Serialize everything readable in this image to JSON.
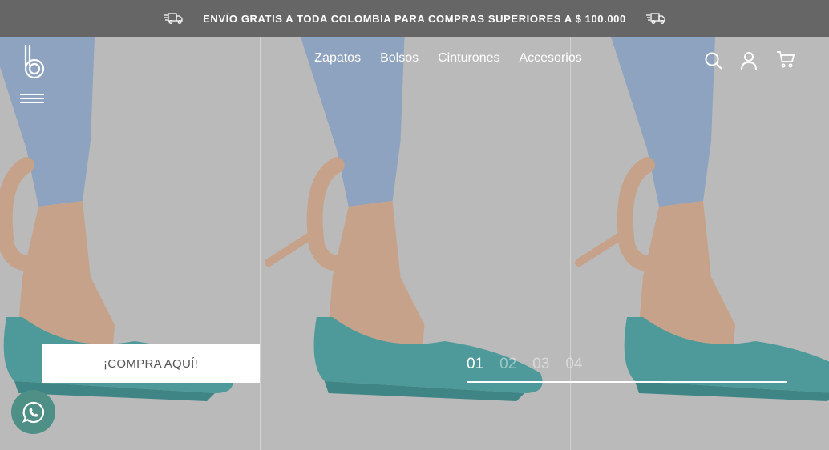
{
  "announcement": {
    "text": "ENVÍO GRATIS A TODA COLOMBIA PARA COMPRAS SUPERIORES A $ 100.000",
    "icons": [
      "truck-icon",
      "truck-icon"
    ]
  },
  "header": {
    "logo_icon": "b-logo-icon",
    "nav": [
      "Zapatos",
      "Bolsos",
      "Cinturones",
      "Accesorios"
    ],
    "icons": [
      "menu-icon",
      "search-icon",
      "user-icon",
      "cart-icon"
    ]
  },
  "hero": {
    "cta_label": "¡COMPRA AQUÍ!",
    "slides": [
      "01",
      "02",
      "03",
      "04"
    ],
    "active_slide": "01",
    "image_description_icon": "teal-ballet-flat-photo"
  },
  "whatsapp": {
    "icon": "whatsapp-icon"
  },
  "colors": {
    "topbar": "#666666",
    "shoe": "#4e9a9a",
    "denim": "#8ea3bf",
    "skin": "#c9a58c",
    "background": "#b9b9b9"
  }
}
